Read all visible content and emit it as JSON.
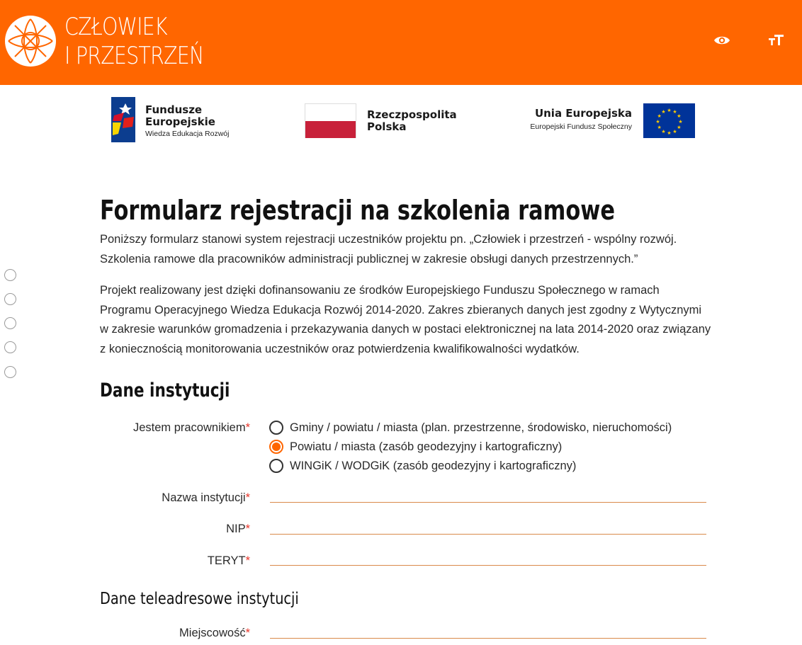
{
  "header": {
    "brand_line1": "CZŁOWIEK",
    "brand_line2": "I PRZESTRZEŃ",
    "logo_icon": "cross-circle-logo-icon",
    "accessibility_icons": [
      "eye-icon",
      "text-size-icon"
    ],
    "accent_color": "#ff6600"
  },
  "partners": {
    "fe_name_line1": "Fundusze",
    "fe_name_line2": "Europejskie",
    "fe_sub": "Wiedza Edukacja Rozwój",
    "rp_line1": "Rzeczpospolita",
    "rp_line2": "Polska",
    "ue_name": "Unia Europejska",
    "ue_sub": "Europejski Fundusz Społeczny"
  },
  "page": {
    "title": "Formularz rejestracji na szkolenia ramowe",
    "intro_lines": [
      "Poniższy formularz stanowi system rejestracji uczestników projektu pn. „Człowiek i przestrzeń - wspólny rozwój.",
      "Szkolenia ramowe dla pracowników administracji publicznej w zakresie obsługi danych przestrzennych.”"
    ],
    "funding_lines": [
      "Projekt realizowany jest dzięki dofinansowaniu ze środków Europejskiego Funduszu Społecznego w ramach",
      "Programu Operacyjnego Wiedza Edukacja Rozwój 2014-2020. Zakres zbieranych danych jest zgodny z Wytycznymi",
      "w zakresie warunków gromadzenia i przekazywania danych w postaci elektronicznej na lata 2014-2020 oraz związany",
      "z koniecznością monitorowania uczestników oraz potwierdzenia kwalifikowalności wydatków."
    ]
  },
  "institution": {
    "section_title": "Dane instytucji",
    "employee_label": "Jestem pracownikiem",
    "required_mark": "*",
    "options": [
      "Gminy / powiatu / miasta (plan. przestrzenne, środowisko, nieruchomości)",
      "Powiatu / miasta (zasób geodezyjny i kartograficzny)",
      "WINGiK / WODGiK (zasób geodezyjny i kartograficzny)"
    ],
    "selected_option": "Powiatu / miasta (zasób geodezyjny i kartograficzny)",
    "name_label": "Nazwa instytucji",
    "name_value": "",
    "nip_label": "NIP",
    "nip_value": "",
    "teryt_label": "TERYT",
    "teryt_value": ""
  },
  "contact": {
    "section_title": "Dane teleadresowe instytucji",
    "city_label": "Miejscowość",
    "city_value": ""
  }
}
